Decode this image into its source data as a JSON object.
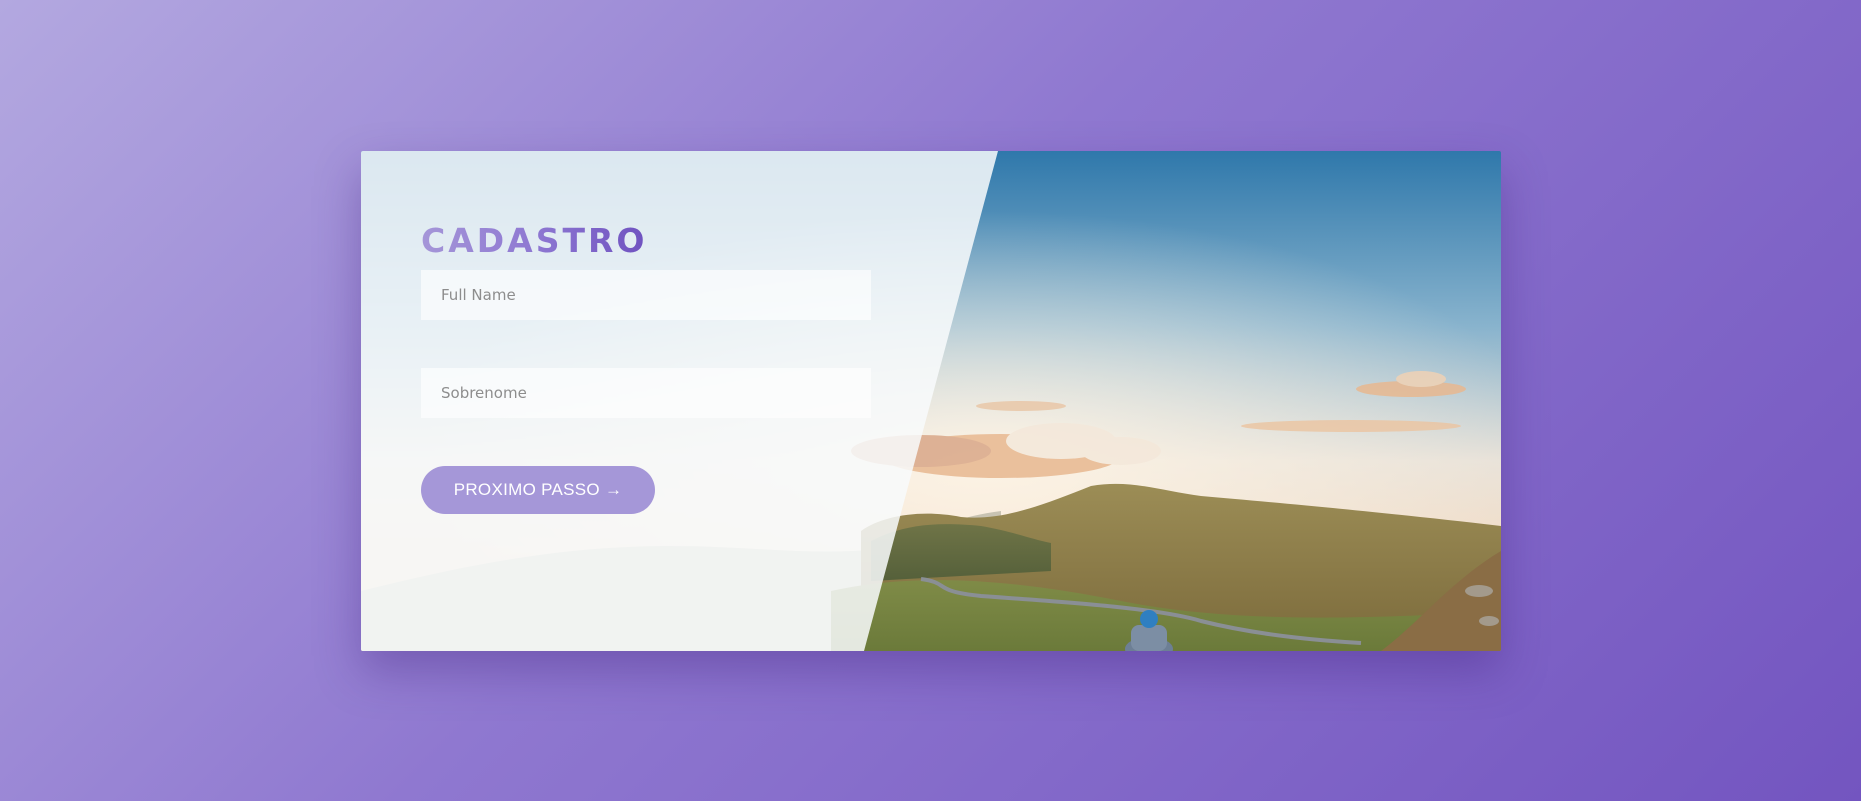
{
  "form": {
    "title": "CADASTRO",
    "fields": [
      {
        "placeholder": "Full Name",
        "value": ""
      },
      {
        "placeholder": "Sobrenome",
        "value": ""
      }
    ],
    "next_button_label": "PROXIMO PASSO →"
  },
  "colors": {
    "background_start": "#b3a8e0",
    "background_end": "#7355c0",
    "accent": "#a597d8",
    "title_gradient_end": "#6f52c0"
  },
  "icons": {
    "next_arrow": "arrow-right-icon"
  }
}
